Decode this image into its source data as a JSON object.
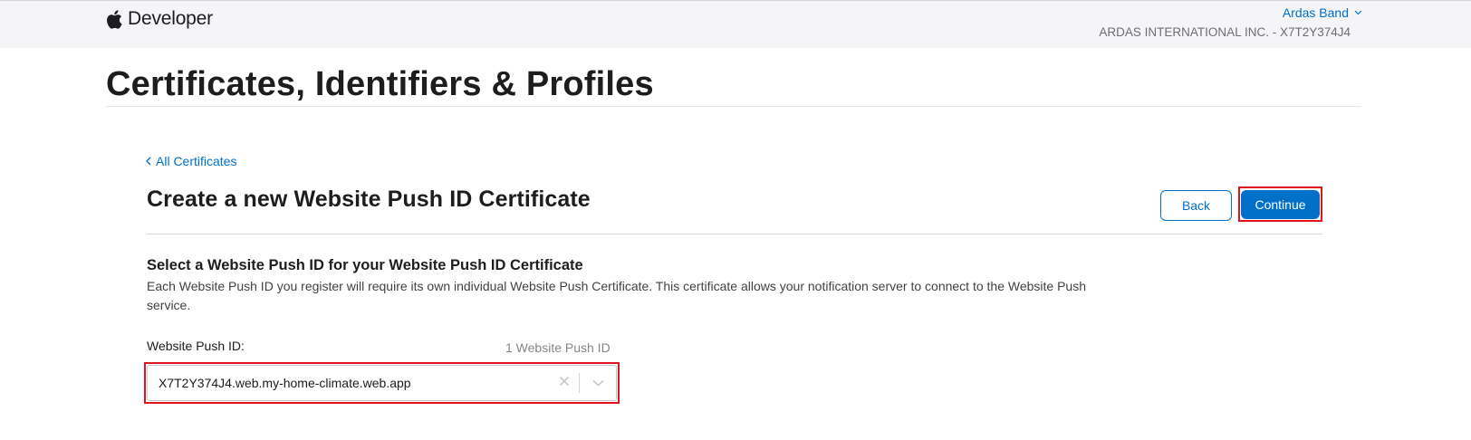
{
  "header": {
    "brand": "Developer",
    "account_name": "Ardas Band",
    "team": "ARDAS INTERNATIONAL INC. - X7T2Y374J4"
  },
  "page": {
    "title": "Certificates, Identifiers & Profiles"
  },
  "nav": {
    "back_link": "All Certificates"
  },
  "section": {
    "title": "Create a new Website Push ID Certificate",
    "back_button": "Back",
    "continue_button": "Continue",
    "subtitle": "Select a Website Push ID for your Website Push ID Certificate",
    "description": "Each Website Push ID you register will require its own individual Website Push Certificate. This certificate allows your notification server to connect to the Website Push service."
  },
  "field": {
    "label": "Website Push ID:",
    "count": "1 Website Push ID",
    "value": "X7T2Y374J4.web.my-home-climate.web.app"
  },
  "colors": {
    "accent": "#0070c9",
    "highlight": "#e0141e"
  },
  "icons": {
    "logo": "apple-logo-icon",
    "account_menu": "chevron-down-icon",
    "back": "chevron-left-icon",
    "clear": "close-icon",
    "dropdown": "chevron-down-icon"
  }
}
